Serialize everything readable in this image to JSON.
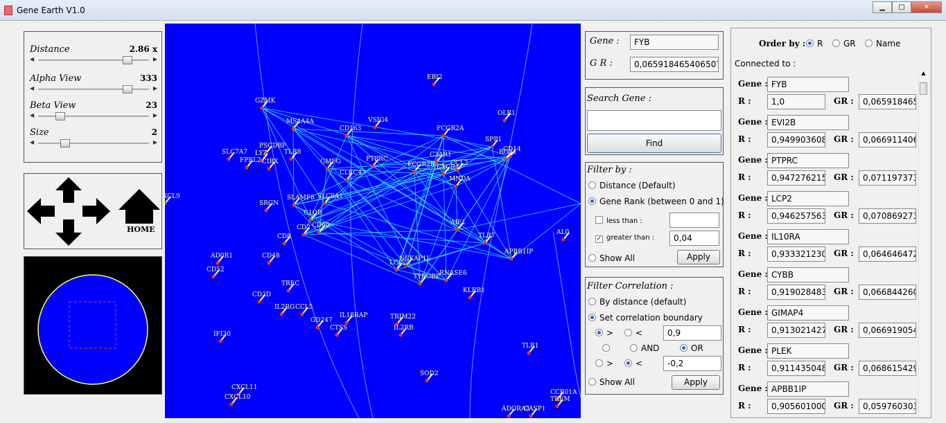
{
  "window": {
    "title": "Gene Earth V1.0"
  },
  "controls": {
    "distance": {
      "label": "Distance",
      "value": "2.86 x",
      "level": 0.8
    },
    "alpha": {
      "label": "Alpha View",
      "value": "333",
      "level": 0.8
    },
    "beta": {
      "label": "Beta View",
      "value": "23",
      "level": 0.15
    },
    "size": {
      "label": "Size",
      "value": "2",
      "level": 0.2
    }
  },
  "nav": {
    "home_label": "HOME"
  },
  "gene_info": {
    "gene_label": "Gene :",
    "gene_value": "FYB",
    "gr_label": "G R :",
    "gr_value": "0,065918465406507"
  },
  "search": {
    "label": "Search Gene :",
    "value": "",
    "find_label": "Find"
  },
  "filter": {
    "title": "Filter by :",
    "opt_distance": "Distance (Default)",
    "opt_rank": "Gene Rank (between 0 and 1)",
    "less_label": "less than :",
    "less_value": "",
    "greater_label": "greater than :",
    "greater_value": "0,04",
    "show_all": "Show All",
    "apply": "Apply"
  },
  "corr": {
    "title": "Filter Correlation :",
    "opt_distance": "By distance (default)",
    "opt_boundary": "Set correlation boundary",
    "gt": ">",
    "lt": "<",
    "upper_value": "0,9",
    "and_label": "AND",
    "or_label": "OR",
    "lower_value": "-0,2",
    "show_all": "Show All",
    "apply": "Apply"
  },
  "connected": {
    "order_label": "Order by :",
    "order_r": "R",
    "order_gr": "GR",
    "order_name": "Name",
    "title": "Connected to :",
    "gene_key": "Gene :",
    "r_key": "R :",
    "gr_key": "GR :",
    "items": [
      {
        "gene": "FYB",
        "r": "1,0",
        "gr": "0,06591846540"
      },
      {
        "gene": "EVI2B",
        "r": "0,94990360889",
        "gr": "0,06691140613"
      },
      {
        "gene": "PTPRC",
        "r": "0,94727621501",
        "gr": "0,07119737362"
      },
      {
        "gene": "LCP2",
        "r": "0,94625756304",
        "gr": "0,07086927313"
      },
      {
        "gene": "IL10RA",
        "r": "0,93332123064",
        "gr": "0,06464647243"
      },
      {
        "gene": "CYBB",
        "r": "0,91902848365",
        "gr": "0,06684426061"
      },
      {
        "gene": "GIMAP4",
        "r": "0,91302142783",
        "gr": "0,06691905496"
      },
      {
        "gene": "PLEK",
        "r": "0,91143504803",
        "gr": "0,06861542948"
      },
      {
        "gene": "APBB1IP",
        "r": "0,90560100019",
        "gr": "0,05976030392"
      }
    ]
  },
  "viz": {
    "nodes": [
      {
        "t": "GZMK"
      },
      {
        "t": "MS4A4A"
      },
      {
        "t": "CD163"
      },
      {
        "t": "VSIG4"
      },
      {
        "t": "EBI2"
      },
      {
        "t": "OLR1"
      },
      {
        "t": "FCGR2A"
      },
      {
        "t": "SPP1"
      },
      {
        "t": "CD14"
      },
      {
        "t": "RGS1"
      },
      {
        "t": "PSCDBP"
      },
      {
        "t": "SLC7A7"
      },
      {
        "t": "LYZ"
      },
      {
        "t": "FPRL2"
      },
      {
        "t": "CIRX"
      },
      {
        "t": "TLR8"
      },
      {
        "t": "GMFG"
      },
      {
        "t": "PTPRC"
      },
      {
        "t": "CLEC4"
      },
      {
        "t": "FCGR2B"
      },
      {
        "t": "C3AR1"
      },
      {
        "t": "CCL2"
      },
      {
        "t": "CXCR4"
      },
      {
        "t": "MNDA"
      },
      {
        "t": "SLAMF8"
      },
      {
        "t": "SRGN"
      },
      {
        "t": "C1QB"
      },
      {
        "t": "CD69"
      },
      {
        "t": "AIF1"
      },
      {
        "t": "TLR7"
      },
      {
        "t": "CD8"
      },
      {
        "t": "APBB1IP"
      },
      {
        "t": "AD0R1"
      },
      {
        "t": "CD48"
      },
      {
        "t": "CD52"
      },
      {
        "t": "TREC"
      },
      {
        "t": "LCP2"
      },
      {
        "t": "TYROBP"
      },
      {
        "t": "RNASE6"
      },
      {
        "t": "KLRB1"
      },
      {
        "t": "CD3D"
      },
      {
        "t": "IL2RG"
      },
      {
        "t": "CCL5"
      },
      {
        "t": "IL18RAP"
      },
      {
        "t": "TRIM22"
      },
      {
        "t": "IL2RB"
      },
      {
        "t": "GD247"
      },
      {
        "t": "CTSS"
      },
      {
        "t": "IFI30"
      },
      {
        "t": "TLR1"
      },
      {
        "t": "SOD2"
      },
      {
        "t": "CXCL11"
      },
      {
        "t": "CXCL10"
      },
      {
        "t": "CCR01A"
      },
      {
        "t": "TREM"
      },
      {
        "t": "ADORA3"
      },
      {
        "t": "CASP1"
      },
      {
        "t": "CXCL9"
      },
      {
        "t": "AL0"
      },
      {
        "t": "SLC8A1"
      },
      {
        "t": "NCKAP1L"
      },
      {
        "t": "CD2"
      }
    ]
  }
}
